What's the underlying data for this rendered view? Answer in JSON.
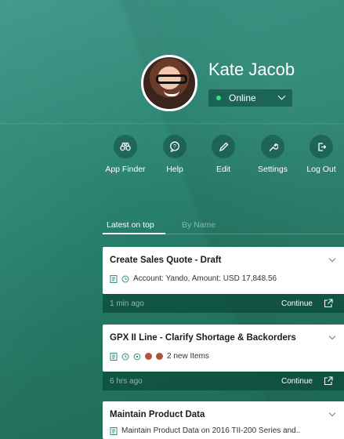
{
  "user": {
    "name": "Kate Jacob",
    "status": "Online"
  },
  "actions": [
    {
      "label": "App Finder",
      "icon": "binoculars-icon"
    },
    {
      "label": "Help",
      "icon": "help-bubble-icon"
    },
    {
      "label": "Edit",
      "icon": "pencil-icon"
    },
    {
      "label": "Settings",
      "icon": "wrench-icon"
    },
    {
      "label": "Log Out",
      "icon": "logout-icon"
    }
  ],
  "tabs": {
    "latest": "Latest on top",
    "by_name": "By Name"
  },
  "cards": [
    {
      "title": "Create Sales Quote - Draft",
      "meta": "Account: Yando, Amount: USD 17,848.56",
      "time": "1 min ago",
      "action": "Continue"
    },
    {
      "title": "GPX II Line - Clarify Shortage & Backorders",
      "meta": "2 new Items",
      "time": "6 hrs ago",
      "action": "Continue"
    },
    {
      "title": "Maintain Product Data",
      "meta": "Maintain Product Data on 2016 TII-200 Series and.."
    }
  ],
  "colors": {
    "accent": "#2f8f7f",
    "status_online": "#32e37a",
    "footer": "#0c4b3c"
  }
}
